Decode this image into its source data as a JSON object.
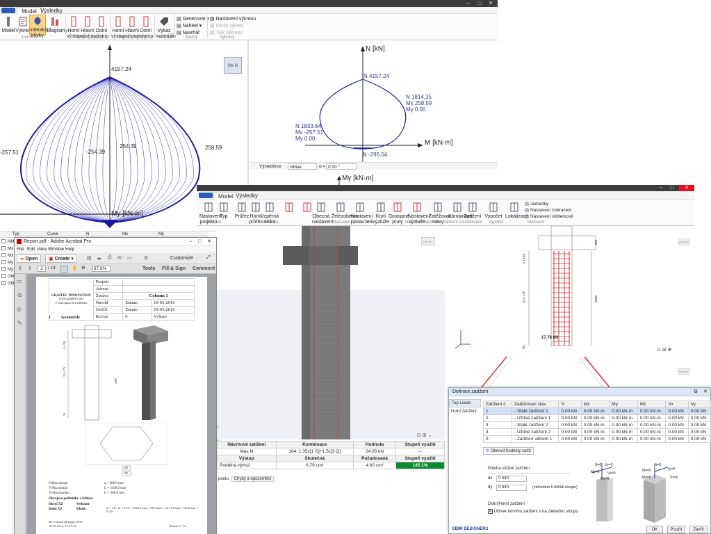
{
  "app1": {
    "tabs": [
      "Model",
      "Výsledky"
    ],
    "buttons": {
      "model": "Model",
      "vykres": "Výkres",
      "interakcni": "Interakční křivky",
      "diagramy": "Diagramy",
      "horni_vystup": "Horní výstup",
      "hlavni_vystup": "Hlavní výstup",
      "dolni_vystup": "Dolní výstup",
      "horni_vystup2": "Horní výstup",
      "hlavni_vystup2": "Hlavní výstup",
      "dolni_vystup2": "Dolní výstup",
      "vykaz": "Výkaz materiálu",
      "generovat": "Generovat",
      "nahled": "Náhled",
      "navrhar": "Navrhář",
      "nastaveni_vykresu": "Nastavení výkresu",
      "ulozit_vykres": "Uložit výkres",
      "tisk_vykresu": "Tisk výkresu"
    },
    "groups": [
      "Zobrazení",
      "Podélný výstup",
      "Smykový výstup",
      "Nástroje",
      "Zprávy",
      "Výkresy"
    ],
    "view_button": "Mx N"
  },
  "diagram3d": {
    "top_value": "4157.24",
    "left_value": "-257.51",
    "right_value": "258.59",
    "mid_left": "-254.39",
    "mid_right": "254.39",
    "axis_label": "My [kN·m]"
  },
  "diagram2d": {
    "axis_n": "N [kN]",
    "axis_m": "M [kN·m]",
    "top_label": "N 4157.24",
    "bottom_label": "N -295.04",
    "right_label": [
      "N 1814.35",
      "Mx 258.59",
      "My 0.00"
    ],
    "left_label": [
      "N 1833.64",
      "Mx -257.51",
      "My 0.00"
    ],
    "toolbar": {
      "vysl": "Výslednice",
      "combo": "NMax",
      "alpha_label": "α =",
      "alpha_value": "0.00 °"
    },
    "my_axis": "My [kN·m]"
  },
  "left_table": {
    "headers": [
      "Typ",
      "Curve",
      "N",
      "Mx",
      "My"
    ],
    "rows": [
      "NM",
      "Mx",
      "Mx",
      "My",
      "My",
      "Obl",
      "Obl"
    ]
  },
  "acrobat": {
    "title": "Report.pdf - Adobe Acrobat Pro",
    "menu": [
      "File",
      "Edit",
      "View",
      "Window",
      "Help"
    ],
    "open": "Open",
    "create": "Create",
    "customize": "Customize",
    "page": "2",
    "pages": "/ 14",
    "zoom": "67.8%",
    "tools": "Tools",
    "fill_sign": "Fill & Sign",
    "comment": "Comment",
    "doc": {
      "company": "GRAITEC INNOVATION",
      "website": "www.graitec.com",
      "address": "17 Burrington 01372 Bekdes",
      "header_cells": [
        "Projekt",
        "Adresa",
        "Zpráva",
        "Navrhl",
        "Ověřil",
        "Revize"
      ],
      "header_right": [
        "Column 1",
        "Datum",
        "Datum",
        "Výkres"
      ],
      "dates": [
        "10-03-2016",
        "10-03-2016"
      ],
      "rev": "0",
      "section": "Geometrie",
      "sect_no": "1",
      "dims_left": [
        "2 x 135",
        "12 x 175",
        "50"
      ],
      "dims_right": [
        "2800"
      ],
      "bottom_dims": [
        "300",
        "300"
      ],
      "props": [
        [
          "Průřez sloupu",
          "a = 300.0 mm"
        ],
        [
          "Výška sloupu",
          "L = 3100.0 mm"
        ],
        [
          "Výška nosníku",
          "h' = 300.0 mm"
        ]
      ],
      "cond_title": "Okrajové podmínky a štíhlost",
      "cond": [
        [
          "Horní XZ",
          "Vetknutí"
        ],
        [
          "Dolní XZ",
          "Kloub"
        ]
      ],
      "formula": "λx = L0 / ix = 0.70 × 3100.0 mm / 136.9 mm = 21.70 0 mm / 136.9 mm = 15.85",
      "footer_left": "BC Column Designer 2017",
      "footer_date": "10-03-2016, 13:27:12",
      "footer_right": "Strana 2 / 14"
    }
  },
  "app2": {
    "tabs": [
      "Model",
      "Výsledky"
    ],
    "buttons": [
      "Nastavení projektu",
      "Typ",
      "Průřez",
      "Horní průřez",
      "Vzpěrná délka",
      "",
      "",
      "Obecná nastavení",
      "Železobeton",
      "Nastavení posouzení",
      "Krytí výztuže",
      "Dostupné pruty",
      "Nastavení výztuže",
      "Zatěžovací stavy",
      "Kombinace",
      "Zatížení",
      "Vypočet",
      "Lokalizace"
    ],
    "side": [
      "Jednotky",
      "Nastavení zobrazení",
      "Nastavení viditelnosti"
    ],
    "groups": [
      "Obecné",
      "Geometrie",
      "Nastavení posouzení",
      "Nastavení výztuže",
      "Zatížení a kombinace",
      "Výpočet",
      "Možnosti"
    ],
    "view_btn": "FRONT",
    "results": {
      "headers1": [
        "Návrhové zatížení",
        "Kombinace",
        "Hodnota",
        "Stupeň využití"
      ],
      "row1": [
        "Max N",
        "104: 1.35x[1 G]+1.5x[3 Q]",
        "24.00 kN",
        "--"
      ],
      "headers2": [
        "Výstup",
        "Skutečná",
        "Požadovaná",
        "Stupeň využití"
      ],
      "row2": [
        "Podélná výztuž",
        "6.79 cm²",
        "4.60 cm²",
        "145.1%"
      ],
      "tabs": [
        "poutu",
        "Chyby a upozornění"
      ]
    },
    "drawing": {
      "dims_left": [
        "2 x 135",
        "12 x 175",
        "50"
      ],
      "dim_right": "2800",
      "top_dim": "300",
      "label": "17.78 kN"
    }
  },
  "dialog": {
    "title": "Definice zatížení",
    "left_items": [
      "Top Loads",
      "Dolní zatížení"
    ],
    "headers": [
      "Zatížení č.",
      "Zatěžovací stav",
      "N",
      "Mx",
      "My",
      "Mz",
      "Vx",
      "Vy"
    ],
    "rows": [
      [
        "1",
        "- Stálé zatížení 1",
        "0.00 kN",
        "0.00 kN·m",
        "0.00 kN·m",
        "0.00 kN·m",
        "0.00 kN",
        "0.00 kN"
      ],
      [
        "2",
        "- Užitné zatížení 1",
        "0.00 kN",
        "0.00 kN·m",
        "0.00 kN·m",
        "0.00 kN·m",
        "0.00 kN",
        "0.00 kN"
      ],
      [
        "3",
        "- Stálé zatížení 2",
        "0.00 kN",
        "0.00 kN·m",
        "0.00 kN·m",
        "0.00 kN·m",
        "0.00 kN",
        "0.00 kN"
      ],
      [
        "4",
        "- Užitné zatížení 2",
        "0.00 kN",
        "0.00 kN·m",
        "0.00 kN·m",
        "0.00 kN·m",
        "0.00 kN",
        "0.00 kN"
      ],
      [
        "5",
        "- Zatížení větrem 1",
        "0.00 kN",
        "0.00 kN·m",
        "0.00 kN·m",
        "0.00 kN·m",
        "0.00 kN",
        "0.00 kN"
      ]
    ],
    "refresh": "Obnovit hodnoty zatíž",
    "pos_title": "Poloha složek zatížení",
    "dx_label": "dx",
    "dx_value": "0 mm",
    "dy_label": "dy",
    "dy_value": "0 mm",
    "pos_note": "(vzhledem k těžišti sloupu)",
    "lower_title": "Dolní/Horní zatížení",
    "checkbox": "Účinek horního zatížení v na základnu sloupu",
    "axis_labels": [
      "N=0",
      "Vy=0",
      "Mx=0",
      "Vx=0",
      "My=0"
    ],
    "buttons": [
      "OK",
      "Použít",
      "Zavřít"
    ],
    "brand": "BIM DESIGNERS"
  },
  "colors": {
    "accent": "#1f3f99",
    "curve": "#1a1aa8",
    "rebar": "#e03030",
    "green": "#0b8a2a"
  }
}
